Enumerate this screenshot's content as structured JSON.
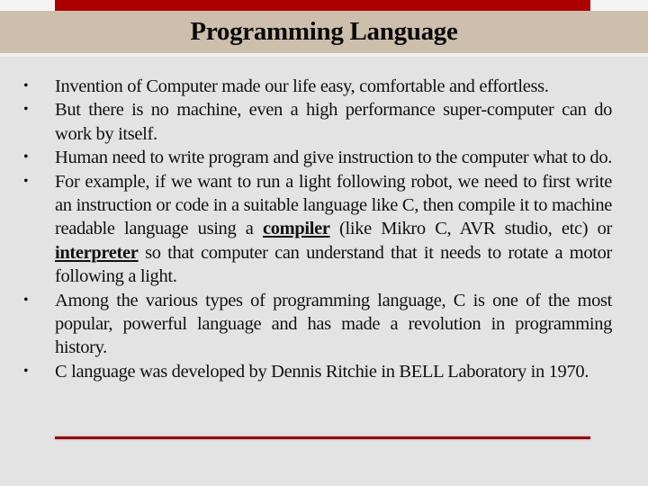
{
  "slide": {
    "title": "Programming Language",
    "colors": {
      "accent_bar": "#ab0000",
      "header_band": "#cdbfac",
      "background": "#e3e3e3",
      "bottom_rule": "#8b0f14"
    },
    "bullets": [
      {
        "text": "Invention of Computer made our life easy, comfortable and  effortless."
      },
      {
        "text": "But there is no machine, even a high performance super-computer can do work by itself."
      },
      {
        "text": "Human need to write program and give instruction to the computer what to do."
      },
      {
        "part1": "For example, if we want to run a light following robot, we need to first write an instruction or code in a suitable language like C, then compile it to machine readable language using a ",
        "term1": "compiler",
        "part2": " (like Mikro C, AVR studio, etc) or ",
        "term2": "interpreter",
        "part3": " so that computer can understand that it needs to rotate a motor following a light."
      },
      {
        "text": "Among the various types of programming language, C is one of the most popular, powerful language and has made a revolution in programming history."
      },
      {
        "text": "C language was developed by Dennis Ritchie in BELL Laboratory in 1970."
      }
    ],
    "bullet_glyph": "•"
  }
}
